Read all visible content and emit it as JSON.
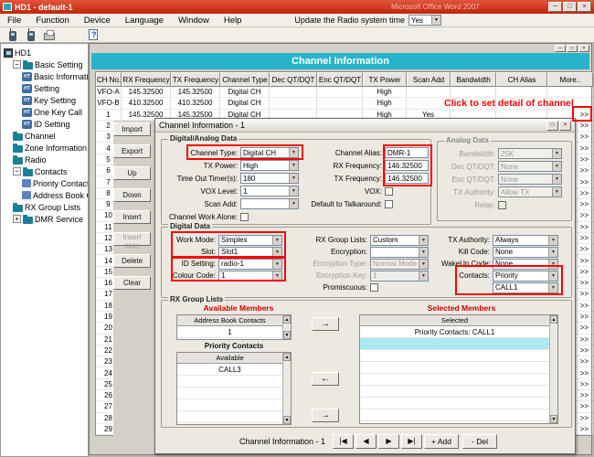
{
  "icons": {
    "minimize": "─",
    "maximize": "□",
    "close": "×",
    "dropdown": "▼",
    "scroll_up": "▲",
    "scroll_down": "▼",
    "arrow_right": "→",
    "arrow_left": "←",
    "ht": "HT"
  },
  "window": {
    "title": "HD1 - default-1",
    "background_title": "Microsoft Office Word 2007"
  },
  "menu": {
    "items": [
      "File",
      "Function",
      "Device",
      "Language",
      "Window",
      "Help"
    ],
    "radio_time_label": "Update the Radio system time",
    "radio_time_value": "Yes"
  },
  "toolbar": {
    "icons": [
      "read-from-radio",
      "write-to-radio",
      "print",
      "help"
    ]
  },
  "tree": {
    "items": [
      {
        "label": "HD1",
        "level": 0,
        "icon": "radio"
      },
      {
        "label": "Basic Setting",
        "level": 1,
        "icon": "folder",
        "expander": "−"
      },
      {
        "label": "Basic Information",
        "level": 2,
        "icon": "ht"
      },
      {
        "label": "Setting",
        "level": 2,
        "icon": "ht"
      },
      {
        "label": "Key Setting",
        "level": 2,
        "icon": "ht"
      },
      {
        "label": "One Key Call",
        "level": 2,
        "icon": "ht"
      },
      {
        "label": "ID Setting",
        "level": 2,
        "icon": "ht"
      },
      {
        "label": "Channel",
        "level": 1,
        "icon": "folder"
      },
      {
        "label": "Zone Information",
        "level": 1,
        "icon": "folder"
      },
      {
        "label": "Radio",
        "level": 1,
        "icon": "folder"
      },
      {
        "label": "Contacts",
        "level": 1,
        "icon": "folder",
        "expander": "−"
      },
      {
        "label": "Priority Contacts",
        "level": 2,
        "icon": "contact"
      },
      {
        "label": "Address Book Contacts",
        "level": 2,
        "icon": "contact"
      },
      {
        "label": "RX Group Lists",
        "level": 1,
        "icon": "folder"
      },
      {
        "label": "DMR Service",
        "level": 1,
        "icon": "folder",
        "expander": "+"
      }
    ]
  },
  "channel_window": {
    "title": "Channel Information",
    "annotation": "Click to set detail of channel",
    "columns": [
      "CH No.",
      "RX Frequency",
      "TX Frequency",
      "Channel Type",
      "Dec QT/DQT",
      "Enc QT/DQT",
      "TX Power",
      "Scan Add",
      "Bandwidth",
      "CH Alias",
      "More.."
    ],
    "rows": [
      [
        "VFO-A",
        "145.32500",
        "145.32500",
        "Digital CH",
        "",
        "",
        "High",
        "",
        "",
        "",
        ""
      ],
      [
        "VFO-B",
        "410.32500",
        "410.32500",
        "Digital CH",
        "",
        "",
        "High",
        "",
        "",
        "",
        ""
      ],
      [
        "1",
        "145.32500",
        "145.32500",
        "Digital CH",
        "",
        "",
        "High",
        "Yes",
        "",
        "",
        ">>"
      ]
    ],
    "numbered_rows": {
      "from": 2,
      "to": 29,
      "more": ">>"
    },
    "buttons": [
      {
        "label": "Import"
      },
      {
        "label": "Export"
      },
      {
        "label": "Up"
      },
      {
        "label": "Down"
      },
      {
        "label": "Insert"
      },
      {
        "label": "Insert copy",
        "disabled": true
      },
      {
        "label": "Delete"
      },
      {
        "label": "Clear"
      }
    ]
  },
  "detail": {
    "title": "Channel Information - 1",
    "digital_analog": {
      "label": "Digital/Analog Data",
      "col1": [
        {
          "label": "Channel Type:",
          "value": "Digital CH",
          "control": "select"
        },
        {
          "label": "TX Power:",
          "value": "High",
          "control": "select"
        },
        {
          "label": "Time Out Timer(s):",
          "value": "180",
          "control": "select"
        },
        {
          "label": "VOX Level:",
          "value": "1",
          "control": "select"
        },
        {
          "label": "Scan Add:",
          "value": "",
          "control": "select"
        },
        {
          "label": "Channel Work Alone:",
          "value": "",
          "control": "checkbox"
        }
      ],
      "col2": [
        {
          "label": "Channel Alias:",
          "value": "DMR-1",
          "control": "input"
        },
        {
          "label": "RX Frequency:",
          "value": "146.32500",
          "control": "input"
        },
        {
          "label": "TX Frequency:",
          "value": "146.32500",
          "control": "input"
        },
        {
          "label": "VOX:",
          "value": "",
          "control": "checkbox"
        },
        {
          "label": "Default to Talkaround:",
          "value": "",
          "control": "checkbox"
        }
      ]
    },
    "analog": {
      "label": "Analog Data",
      "fields": [
        {
          "label": "Bandwidth:",
          "value": "25K",
          "control": "select",
          "disabled": true
        },
        {
          "label": "Dec QT/DQT:",
          "value": "None",
          "control": "select",
          "disabled": true
        },
        {
          "label": "Enc QT/DQT:",
          "value": "None",
          "control": "select",
          "disabled": true
        },
        {
          "label": "TX Authority:",
          "value": "Allow TX",
          "control": "select",
          "disabled": true
        },
        {
          "label": "Relay:",
          "value": "",
          "control": "checkbox",
          "disabled": true
        }
      ]
    },
    "digital": {
      "label": "Digital Data",
      "col1": [
        {
          "label": "Work Mode:",
          "value": "Simplex",
          "control": "select"
        },
        {
          "label": "Slot:",
          "value": "Slot1",
          "control": "select"
        },
        {
          "label": "ID Setting:",
          "value": "radio-1",
          "control": "select"
        },
        {
          "label": "Colour Code:",
          "value": "1",
          "control": "select"
        }
      ],
      "col2": [
        {
          "label": "RX Group Lists:",
          "value": "Custom",
          "control": "select"
        },
        {
          "label": "Encryption:",
          "value": "",
          "control": "select"
        },
        {
          "label": "Encryption Type:",
          "value": "Normal Mode",
          "control": "select",
          "disabled": true
        },
        {
          "label": "Encryption Key:",
          "value": "1",
          "control": "select",
          "disabled": true
        },
        {
          "label": "Promiscuous:",
          "value": "",
          "control": "checkbox"
        }
      ],
      "col3": [
        {
          "label": "TX Authority:",
          "value": "Always",
          "control": "select"
        },
        {
          "label": "Kill Code:",
          "value": "None",
          "control": "select"
        },
        {
          "label": "WakeUp Code:",
          "value": "None",
          "control": "select"
        },
        {
          "label": "Contacts:",
          "value": "Priority",
          "control": "select"
        },
        {
          "label": "",
          "value": "CALL1",
          "control": "select"
        }
      ]
    },
    "rx_groups": {
      "label": "RX Group Lists",
      "available_title": "Available Members",
      "selected_title": "Selected Members",
      "pc_title": "Priority Contacts",
      "abc": {
        "header": "Address Book Contacts",
        "rows": [
          "1"
        ]
      },
      "pc": {
        "header": "Available",
        "rows": [
          "CALL3"
        ]
      },
      "selected": {
        "header": "Selected",
        "rows": [
          "Priority Contacts: CALL1"
        ],
        "highlight_index": 1
      }
    },
    "bottom": {
      "status": "Channel Information - 1",
      "nav": [
        "|◀",
        "◀",
        "▶",
        "▶|"
      ],
      "add_label": "+ Add",
      "del_label": "- Del"
    }
  }
}
